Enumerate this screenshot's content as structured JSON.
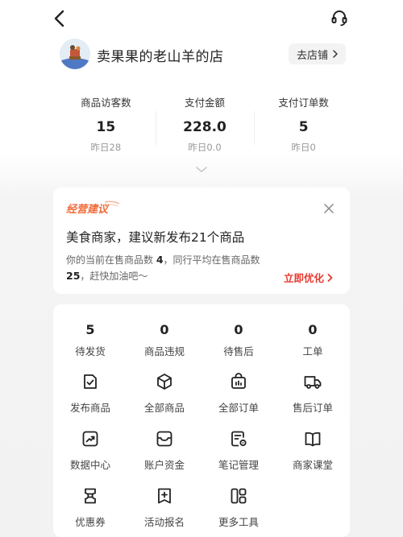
{
  "shop": {
    "name": "卖果果的老山羊的店",
    "link_label": "去店铺"
  },
  "stats": [
    {
      "label": "商品访客数",
      "value": "15",
      "prev": "昨日28"
    },
    {
      "label": "支付金额",
      "value": "228.0",
      "prev": "昨日0.0"
    },
    {
      "label": "支付订单数",
      "value": "5",
      "prev": "昨日0"
    }
  ],
  "suggestion": {
    "tag": "经营建议",
    "title": "美食商家，建议新发布21个商品",
    "body_prefix": "你的当前在售商品数 ",
    "body_count": "4",
    "body_middle": "，同行平均在售商品数",
    "body_avg": "25",
    "body_suffix": "，赶快加油吧～",
    "action": "立即优化"
  },
  "counts": [
    {
      "value": "5",
      "label": "待发货"
    },
    {
      "value": "0",
      "label": "商品违规"
    },
    {
      "value": "0",
      "label": "待售后"
    },
    {
      "value": "0",
      "label": "工单"
    }
  ],
  "tools": [
    {
      "label": "发布商品",
      "icon": "publish-product-icon"
    },
    {
      "label": "全部商品",
      "icon": "box-icon"
    },
    {
      "label": "全部订单",
      "icon": "order-bag-icon"
    },
    {
      "label": "售后订单",
      "icon": "truck-icon"
    },
    {
      "label": "数据中心",
      "icon": "chart-icon"
    },
    {
      "label": "账户资金",
      "icon": "wallet-icon"
    },
    {
      "label": "笔记管理",
      "icon": "note-settings-icon"
    },
    {
      "label": "商家课堂",
      "icon": "book-icon"
    },
    {
      "label": "优惠券",
      "icon": "coupon-icon"
    },
    {
      "label": "活动报名",
      "icon": "activity-signup-icon"
    },
    {
      "label": "更多工具",
      "icon": "more-tools-icon"
    }
  ],
  "colors": {
    "accent_red": "#e8382e",
    "tag_orange": "#f26b3a",
    "background": "#f2f2f2"
  }
}
